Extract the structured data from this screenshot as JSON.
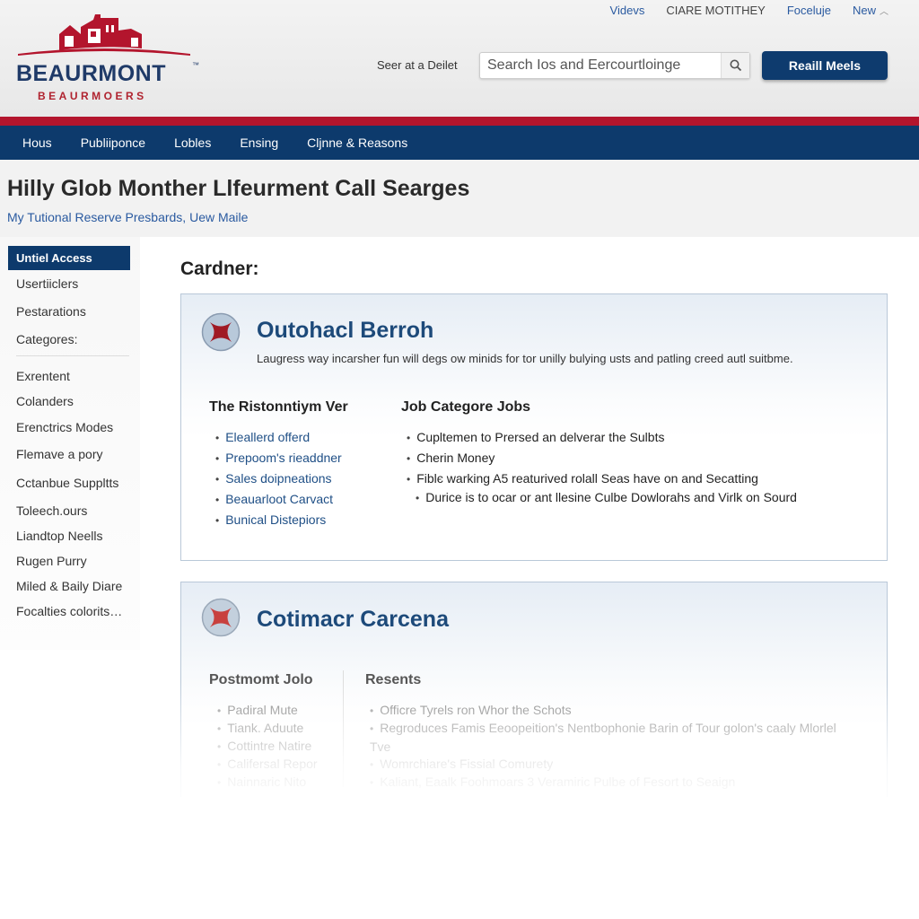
{
  "header": {
    "logo": {
      "name": "BEAURMONT",
      "tm": "™",
      "sub": "BEAURMOERS"
    },
    "top_links": [
      {
        "label": "Videvs"
      },
      {
        "label": "CIARE MOTITHEY"
      },
      {
        "label": "Foceluje"
      },
      {
        "label": "New"
      }
    ],
    "search_label": "Seer at a Deilet",
    "search_value": "Search Ios and Eercourtloinge",
    "search_icon": "search-icon",
    "cta_label": "Reaill Meels"
  },
  "colors": {
    "brand_navy": "#0d3a6c",
    "brand_red": "#b3152d",
    "link_blue": "#2a5aa0"
  },
  "nav": {
    "items": [
      {
        "label": "Hous"
      },
      {
        "label": "Publiiponce"
      },
      {
        "label": "Lobles"
      },
      {
        "label": "Ensing"
      },
      {
        "label": "Cljnne & Reasons"
      }
    ]
  },
  "page": {
    "title": "Hilly Glob Monther Llfeurment Call Searges",
    "breadcrumb": "My Tutional Reserve Presbards, Uew Maile"
  },
  "sidebar": {
    "active": "Untiel Access",
    "items": [
      {
        "label": "Usertiiclers"
      },
      {
        "label": "Pestarations"
      },
      {
        "label": "Categores:"
      },
      {
        "label": "Exrentent"
      },
      {
        "label": "Colanders"
      },
      {
        "label": "Erenctrics Modes"
      },
      {
        "label": "Flemave a pory"
      },
      {
        "label": "Cctanbue Suppltts"
      },
      {
        "label": "Toleech.ours"
      },
      {
        "label": "Liandtop Neells"
      },
      {
        "label": "Rugen Purry"
      },
      {
        "label": "Miled & Baily Diare"
      },
      {
        "label": "Focalties colorits…"
      }
    ]
  },
  "main": {
    "heading": "Cardner:",
    "cards": [
      {
        "title": "Outohacl Berroh",
        "desc": "Laugress way incarsher fun will degs ow minids for tor unilly bulying usts and patling creed autl suitbme.",
        "col1": {
          "heading": "The Ristonntiym Ver",
          "items": [
            "Eleallerd offerd",
            "Prepoom's rieaddner",
            "Sales doipneations",
            "Beauarloot Carvact",
            "Bunical Distepiors"
          ]
        },
        "col2": {
          "heading": "Job Categore Jobs",
          "items": [
            "Cupltemen to Prersed an delverar the Sulbts",
            "Cherin Money",
            "Fiblє warking A5 reaturived rolall Seas have on and Secatting",
            "Durice is to ocar or ant llesine Culbe Dowlorahs and Virlk on Sourd"
          ]
        }
      },
      {
        "title": "Cotimacr Carcena",
        "col1": {
          "heading": "Postmomt Jolo",
          "items": [
            "Padiral Mute",
            "Tiank. Aduute",
            "Cottintre Natire",
            "Califersal Repor",
            "Nainnaric Nito"
          ]
        },
        "col2": {
          "heading": "Resents",
          "items": [
            "Officre Tyrels ron Whor the Schots",
            "Regroduces Famis Eeoopeition's Nentbophonie Barin of Tour golon's caaly Mlorlel Tve",
            "Womrchiare's Fissial Comurety",
            "Kaliant, Eaalk Foohmoars 3 Veramiric Pulbe of Fesort to Seaign"
          ]
        }
      }
    ]
  }
}
